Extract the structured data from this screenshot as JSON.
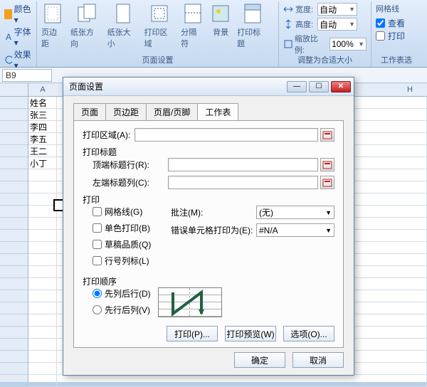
{
  "ribbon": {
    "themes": {
      "colors": "颜色 ▾",
      "fonts": "字体 ▾",
      "effects": "效果 ▾"
    },
    "page_setup": {
      "margins": "页边距",
      "orientation": "纸张方向",
      "size": "纸张大小",
      "print_area": "打印区域",
      "breaks": "分隔符",
      "background": "背景",
      "print_titles": "打印标题",
      "group_label": "页面设置"
    },
    "scale": {
      "width_lbl": "宽度:",
      "width_val": "自动",
      "height_lbl": "高度:",
      "height_val": "自动",
      "ratio_lbl": "缩放比例:",
      "ratio_val": "100%",
      "group_label": "调整为合适大小"
    },
    "gridlines": {
      "title": "网格线",
      "view": "查看",
      "print": "打印",
      "group_label": "工作表选"
    }
  },
  "namebox": "B9",
  "columns": [
    "A",
    "H"
  ],
  "rows": [
    "姓名",
    "张三",
    "李四",
    "李五",
    "王二",
    "小丁"
  ],
  "dialog": {
    "title": "页面设置",
    "tabs": [
      "页面",
      "页边距",
      "页眉/页脚",
      "工作表"
    ],
    "active_tab_index": 3,
    "highlight_tab_index": 2,
    "print_area_lbl": "打印区域(A):",
    "print_titles_lbl": "打印标题",
    "top_rows_lbl": "顶端标题行(R):",
    "left_cols_lbl": "左端标题列(C):",
    "print_section_lbl": "打印",
    "chk_grid": "网格线(G)",
    "chk_mono": "单色打印(B)",
    "chk_draft": "草稿品质(Q)",
    "chk_rowcol": "行号列标(L)",
    "comments_lbl": "批注(M):",
    "comments_val": "(无)",
    "errors_lbl": "错误单元格打印为(E):",
    "errors_val": "#N/A",
    "order_lbl": "打印顺序",
    "order_down": "先列后行(D)",
    "order_over": "先行后列(V)",
    "btn_print": "打印(P)...",
    "btn_preview": "打印预览(W)",
    "btn_options": "选项(O)...",
    "btn_ok": "确定",
    "btn_cancel": "取消"
  }
}
